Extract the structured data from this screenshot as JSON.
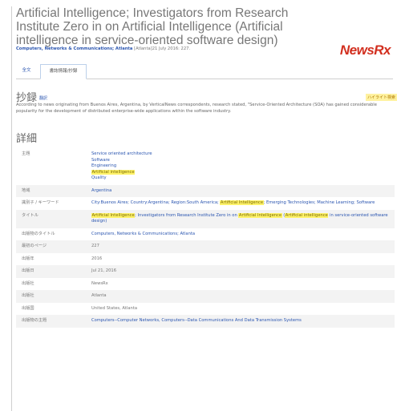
{
  "page": {
    "title": "Artificial Intelligence; Investigators from Research Institute Zero in on Artificial Intelligence (Artificial intelligence in service-oriented software design)",
    "publication": "Computers, Networks & Communications; Atlanta",
    "pub_meta": "[Atlanta]21 July 2016: 227.",
    "logo": "NewsRx"
  },
  "tabs": [
    {
      "label": "全文"
    },
    {
      "label": "書誌情報/抄録"
    }
  ],
  "abstract": {
    "heading": "抄録",
    "sub_link": "翻訳",
    "translate_label": "ハイライト検索",
    "text": "According to news originating from Buenos Aires, Argentina, by VerticalNews correspondents, research stated, \"Service-Oriented Architecture (SOA) has gained considerable popularity for the development of distributed enterprise-wide applications within the software industry."
  },
  "details": {
    "heading": "詳細",
    "rows": [
      {
        "key": "主題",
        "values": [
          "Service oriented architecture",
          "Software",
          "Engineering",
          "Artificial intelligence",
          "Quality"
        ]
      },
      {
        "key": "地域",
        "values": [
          "Argentina"
        ]
      },
      {
        "key": "識別子 / キーワード",
        "text": "City:Buenos Aires; Country:Argentina; Region:South America; Artificial Intelligence; Emerging Technologies; Machine Learning; Software"
      },
      {
        "key": "タイトル",
        "text": "Artificial Intelligence; Investigators from Research Institute Zero in on Artificial Intelligence (Artificial intelligence in service-oriented software design)"
      },
      {
        "key": "出版物のタイトル",
        "text": "Computers, Networks & Communications; Atlanta"
      },
      {
        "key": "最初のページ",
        "text": "227"
      },
      {
        "key": "出版年",
        "text": "2016"
      },
      {
        "key": "出版日",
        "text": "Jul 21, 2016"
      },
      {
        "key": "出版社",
        "text": "NewsRx"
      },
      {
        "key": "出版社",
        "text": "Atlanta"
      },
      {
        "key": "出版国",
        "text": "United States, Atlanta"
      },
      {
        "key": "出版物の主題",
        "text": "Computers--Computer Networks, Computers--Data Communications And Data Transmission Systems"
      }
    ]
  },
  "highlight_color": "#fff36a",
  "link_color": "#2a55b0",
  "logo_color": "#d22f1f"
}
